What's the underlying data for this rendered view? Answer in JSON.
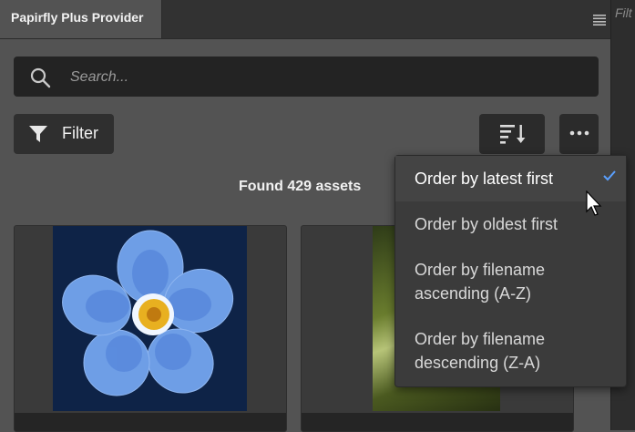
{
  "panel": {
    "tab_title": "Papirfly Plus Provider",
    "ghost_tab_text": "Filt"
  },
  "search": {
    "placeholder": "Search...",
    "value": ""
  },
  "toolbar": {
    "filter_label": "Filter"
  },
  "results": {
    "count_text": "Found 429 assets"
  },
  "sort_menu": {
    "items": [
      {
        "label": "Order by latest first",
        "selected": true
      },
      {
        "label": "Order by oldest first",
        "selected": false
      },
      {
        "label_line1": "Order by filename",
        "label_line2": "ascending (A-Z)",
        "selected": false
      },
      {
        "label_line1": "Order by filename",
        "label_line2": "descending (Z-A)",
        "selected": false
      }
    ]
  },
  "colors": {
    "accent": "#5aa0ff",
    "panel_bg": "#535353",
    "menu_bg": "#3b3b3b"
  },
  "icons": [
    "panel-menu-icon",
    "search-icon",
    "filter-icon",
    "sort-icon",
    "more-icon",
    "check-icon",
    "cursor-icon"
  ]
}
